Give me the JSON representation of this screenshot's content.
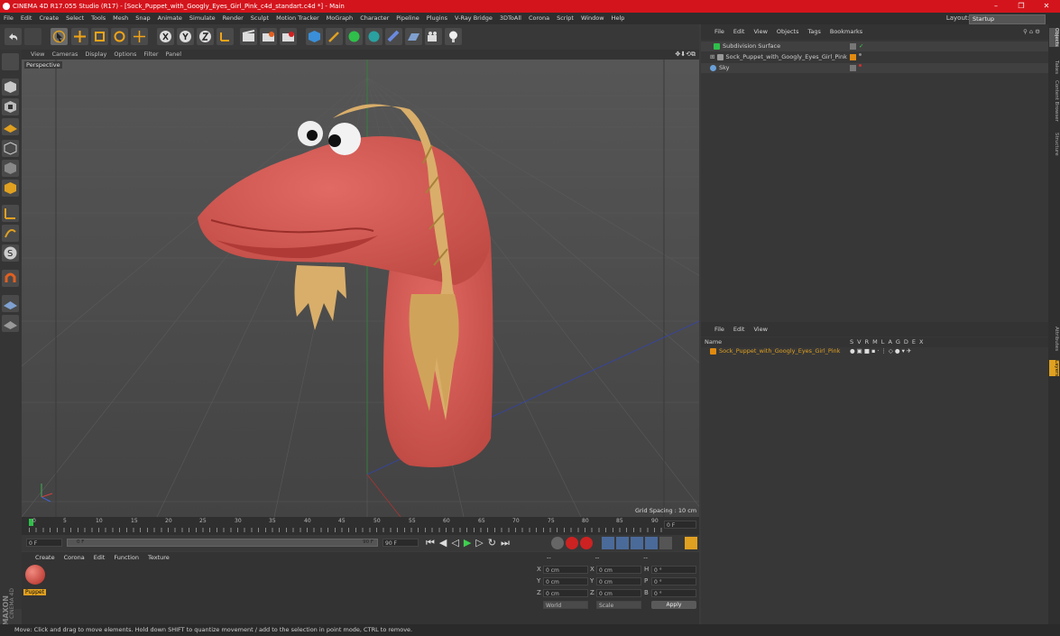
{
  "window": {
    "title": "CINEMA 4D R17.055 Studio (R17) - [Sock_Puppet_with_Googly_Eyes_Girl_Pink_c4d_standart.c4d *] - Main",
    "minimize": "–",
    "maximize": "❐",
    "close": "✕"
  },
  "menubar": {
    "items": [
      "File",
      "Edit",
      "Create",
      "Select",
      "Tools",
      "Mesh",
      "Snap",
      "Animate",
      "Simulate",
      "Render",
      "Sculpt",
      "Motion Tracker",
      "MoGraph",
      "Character",
      "Pipeline",
      "Plugins",
      "V-Ray Bridge",
      "3DToAll",
      "Corona",
      "Script",
      "Window",
      "Help"
    ],
    "layout_label": "Layout:",
    "layout_value": "Startup"
  },
  "viewport": {
    "menu": [
      "View",
      "Cameras",
      "Display",
      "Options",
      "Filter",
      "Panel"
    ],
    "label": "Perspective",
    "grid_spacing": "Grid Spacing : 10 cm"
  },
  "timeline": {
    "ticks": [
      "0",
      "5",
      "10",
      "15",
      "20",
      "25",
      "30",
      "35",
      "40",
      "45",
      "50",
      "55",
      "60",
      "65",
      "70",
      "75",
      "80",
      "85",
      "90"
    ],
    "frame_field": "0 F",
    "start_field": "0 F",
    "range_start": "0 F",
    "range_end": "90 F",
    "end_field": "90 F"
  },
  "material_panel": {
    "menu": [
      "Create",
      "Corona",
      "Edit",
      "Function",
      "Texture"
    ],
    "material_name": "Puppet",
    "brand": "MAXON",
    "brand2": "CINEMA 4D"
  },
  "coords": {
    "header": [
      "--",
      "--",
      "--"
    ],
    "rows": [
      {
        "a": "X",
        "av": "0 cm",
        "b": "X",
        "bv": "0 cm",
        "c": "H",
        "cv": "0 °"
      },
      {
        "a": "Y",
        "av": "0 cm",
        "b": "Y",
        "bv": "0 cm",
        "c": "P",
        "cv": "0 °"
      },
      {
        "a": "Z",
        "av": "0 cm",
        "b": "Z",
        "bv": "0 cm",
        "c": "B",
        "cv": "0 °"
      }
    ],
    "mode1": "World",
    "mode2": "Scale",
    "apply": "Apply"
  },
  "object_manager": {
    "menu": [
      "File",
      "Edit",
      "View",
      "Objects",
      "Tags",
      "Bookmarks"
    ],
    "objects": [
      {
        "name": "Subdivision Surface",
        "color": "#2fbf4a"
      },
      {
        "name": "Sock_Puppet_with_Googly_Eyes_Girl_Pink",
        "color": "#9a9a9a"
      },
      {
        "name": "Sky",
        "color": "#6aa0d8"
      }
    ]
  },
  "layer_manager": {
    "menu": [
      "File",
      "Edit",
      "View"
    ],
    "col_name": "Name",
    "cols": [
      "S",
      "V",
      "R",
      "M",
      "L",
      "A",
      "G",
      "D",
      "E",
      "X"
    ],
    "layer_name": "Sock_Puppet_with_Googly_Eyes_Girl_Pink",
    "layer_color": "#e08a10"
  },
  "side_tabs": [
    "Objects",
    "Takes",
    "Content Browser",
    "Structure",
    "Attributes",
    "Layers"
  ],
  "status": "Move: Click and drag to move elements. Hold down SHIFT to quantize movement / add to the selection in point mode, CTRL to remove."
}
